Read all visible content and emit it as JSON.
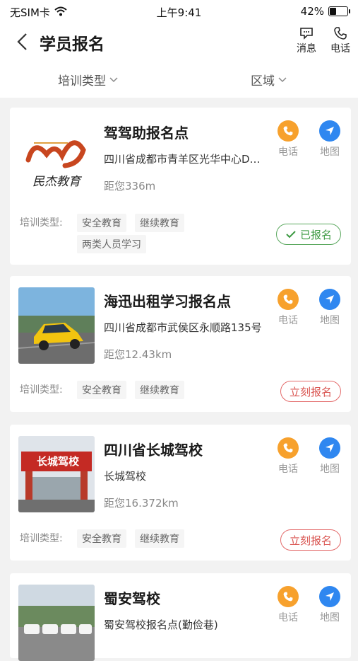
{
  "status_bar": {
    "carrier": "无SIM卡",
    "time": "上午9:41",
    "battery": "42%",
    "battery_level": 0.42
  },
  "header": {
    "title": "学员报名",
    "messages_label": "消息",
    "phone_label": "电话"
  },
  "filters": {
    "type_label": "培训类型",
    "region_label": "区域"
  },
  "common": {
    "phone_label": "电话",
    "map_label": "地图",
    "training_type_label": "培训类型:"
  },
  "schools": [
    {
      "name": "驾驾助报名点",
      "address": "四川省成都市青羊区光华中心D…",
      "distance": "距您336m",
      "logo_text": "民杰教育",
      "tags": [
        "安全教育",
        "继续教育",
        "两类人员学习"
      ],
      "status": "已报名"
    },
    {
      "name": "海迅出租学习报名点",
      "address": "四川省成都市武侯区永顺路135号",
      "distance": "距您12.43km",
      "tags": [
        "安全教育",
        "继续教育"
      ],
      "status": "立刻报名"
    },
    {
      "name": "四川省长城驾校",
      "address": "长城驾校",
      "distance": "距您16.372km",
      "sign_text": "长城驾校",
      "tags": [
        "安全教育",
        "继续教育"
      ],
      "status": "立刻报名"
    },
    {
      "name": "蜀安驾校",
      "address": "蜀安驾校报名点(勤俭巷)"
    }
  ]
}
